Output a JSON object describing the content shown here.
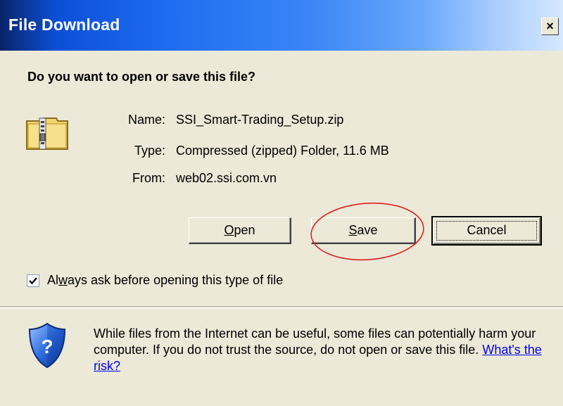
{
  "window": {
    "title": "File Download",
    "close_label": "×"
  },
  "dialog": {
    "question": "Do you want to open or save this file?",
    "file": {
      "icon": "zip-folder-icon",
      "name_label": "Name:",
      "name_value": "SSI_Smart-Trading_Setup.zip",
      "type_label": "Type:",
      "type_value": "Compressed (zipped) Folder, 11.6 MB",
      "from_label": "From:",
      "from_value": "web02.ssi.com.vn"
    },
    "buttons": {
      "open_mnemonic": "O",
      "open_rest": "pen",
      "save_mnemonic": "S",
      "save_rest": "ave",
      "cancel": "Cancel"
    },
    "checkbox": {
      "checked": true,
      "label_pre": "Al",
      "label_mnemonic": "w",
      "label_post": "ays ask before opening this type of file"
    },
    "warning": {
      "icon": "security-shield-icon",
      "text": "While files from the Internet can be useful, some files can potentially harm your computer. If you do not trust the source, do not open or save this file.",
      "link": "What's the risk?"
    }
  },
  "colors": {
    "titlebar_start": "#0a246a",
    "titlebar_end": "#d6e8ff",
    "dialog_bg": "#ece9d8",
    "highlight_ellipse": "#e02020",
    "link": "#0000ee"
  }
}
